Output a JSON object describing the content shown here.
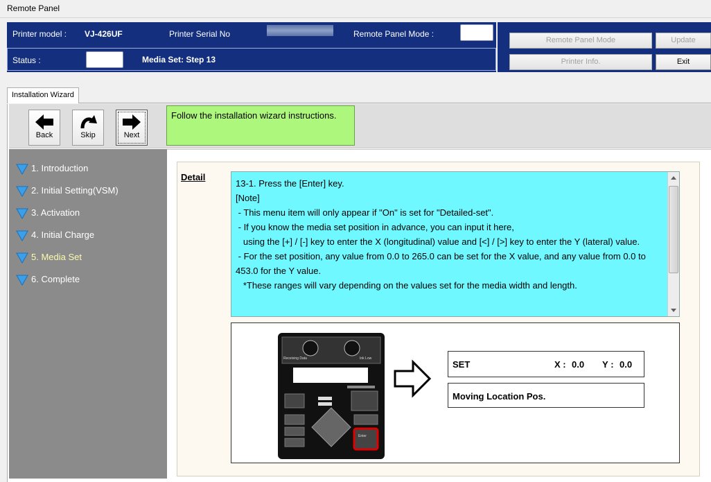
{
  "window": {
    "title": "Remote Panel"
  },
  "header": {
    "printer_model_label": "Printer model :",
    "printer_model_value": "VJ-426UF",
    "serial_label": "Printer Serial No",
    "remote_mode_label": "Remote Panel Mode :",
    "status_label": "Status :",
    "status_value": "Media Set: Step 13"
  },
  "buttons": {
    "remote_panel_mode": "Remote Panel Mode",
    "update": "Update",
    "printer_info": "Printer Info.",
    "exit": "Exit"
  },
  "tabs": [
    {
      "label": "Installation Wizard"
    }
  ],
  "toolbar": {
    "back": "Back",
    "skip": "Skip",
    "next": "Next"
  },
  "instruction": "Follow the installation wizard instructions.",
  "steps": [
    {
      "label": "1. Introduction"
    },
    {
      "label": "2. Initial Setting(VSM)"
    },
    {
      "label": "3. Activation"
    },
    {
      "label": "4. Initial Charge"
    },
    {
      "label": "5. Media Set"
    },
    {
      "label": "6. Complete"
    }
  ],
  "detail": {
    "label": "Detail",
    "text": "13-1. Press the [Enter] key.\n[Note]\n - This menu item will only appear if \"On\" is set for \"Detailed-set\".\n - If you know the media set position in advance, you can input it here,\n   using the [+] / [-] key to enter the X (longitudinal) value and [<] / [>] key to enter the Y (lateral) value.\n - For the set position, any value from 0.0 to 265.0 can be set for the X value, and any value from 0.0 to 453.0 for the Y value.\n   *These ranges will vary depending on the values set for the media width and length."
  },
  "display": {
    "set_label": "SET",
    "x_label": "X : ",
    "x_value": "0.0",
    "y_label": "Y : ",
    "y_value": "0.0",
    "line2": "Moving Location Pos."
  },
  "panel_labels": {
    "receiving": "Receiving Data",
    "ink_low": "Ink Low",
    "enter": "Enter"
  },
  "colors": {
    "header_bg": "#142f7e",
    "sidebar_bg": "#8b8b8b",
    "detail_bg": "#6ff8ff",
    "instruction_bg": "#aef77d",
    "active_step": "#fbfbae",
    "step_icon": "#3aa0e8"
  }
}
